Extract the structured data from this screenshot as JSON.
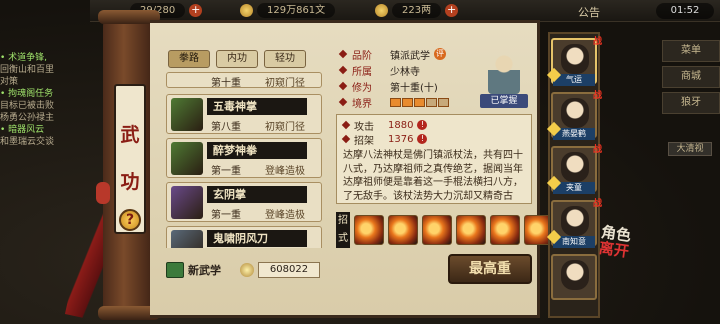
{
  "topbar": {
    "resource1": "29/280",
    "resource2": "129万861文",
    "resource3": "223两",
    "announce": "公告",
    "clock": "01:52"
  },
  "quests": [
    {
      "head": "• 术道争锋,",
      "sub": "回衡山和百里"
    },
    {
      "head": "",
      "sub": "对策"
    },
    {
      "head": "• 拘魂阁任务",
      "sub": "目标已被击败"
    },
    {
      "head": "",
      "sub": "杨勇公孙禄主"
    },
    {
      "head": "• 暗器风云",
      "sub": "和墨瑞云交谈"
    }
  ],
  "right_menu": [
    "菜单",
    "商城",
    "狼牙"
  ],
  "chat_label": "大清视",
  "panel": {
    "title_1": "武",
    "title_2": "功",
    "help": "?",
    "tabs": [
      {
        "label": "拳路",
        "active": true
      },
      {
        "label": "内功",
        "active": false
      },
      {
        "label": "轻功",
        "active": false
      }
    ],
    "skills": [
      {
        "name": "",
        "level": "第十重",
        "realm": "初窥门径",
        "color": "#8a6a3a",
        "partial": true
      },
      {
        "name": "五毒神掌",
        "level": "第八重",
        "realm": "初窥门径",
        "color": "#4f7a34",
        "partial": false
      },
      {
        "name": "醉梦神拳",
        "level": "第一重",
        "realm": "登峰造极",
        "color": "#4f7a34",
        "partial": false
      },
      {
        "name": "玄阴掌",
        "level": "第一重",
        "realm": "登峰造极",
        "color": "#6a4a8a",
        "partial": false
      },
      {
        "name": "鬼啸阴风刀",
        "level": "第一重",
        "realm": "初窥门径",
        "color": "#5a6a7a",
        "partial": false
      }
    ],
    "new_skill_label": "新武学",
    "points": "608022",
    "detail": {
      "grade_key": "品阶",
      "grade_val": "镇派武学",
      "grade_badge": "评",
      "school_key": "所属",
      "school_val": "少林寺",
      "cultivation_key": "修为",
      "cultivation_val": "第十重(十)",
      "realm_key": "境界",
      "realm_filled": 3,
      "realm_total": 5
    },
    "portrait_caption": "已掌握",
    "stats": [
      {
        "k": "攻击",
        "v": "1880"
      },
      {
        "k": "招架",
        "v": "1376"
      }
    ],
    "description": "达摩八法神杖是佛门镇派杖法，共有四十八式，乃达摩祖师之真传绝艺，据闻当年达摩祖师便是靠着这一手棍法横扫八方，了无敌手。该杖法势大力沉却又精奇古朴，招式中极为注重左右互易，前后中更，刚柔相",
    "moves_label": "招式",
    "move_count": 6,
    "max_button": "最高重"
  },
  "roster": [
    {
      "name": "气运",
      "tag": "战",
      "active": true
    },
    {
      "name": "燕晏鹤",
      "tag": "战",
      "active": false
    },
    {
      "name": "夹童",
      "tag": "战",
      "active": false
    },
    {
      "name": "南知意",
      "tag": "战",
      "active": false
    },
    {
      "name": "",
      "tag": "",
      "active": false
    }
  ],
  "role_tag": {
    "line1": "角色",
    "line2": "离开"
  }
}
